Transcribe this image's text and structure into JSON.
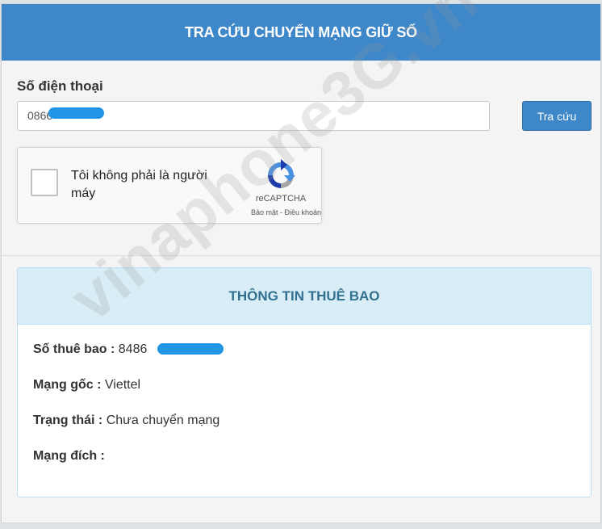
{
  "header": {
    "title": "TRA CỨU CHUYỂN MẠNG GIỮ SỐ"
  },
  "form": {
    "phone_label": "Số điện thoại",
    "phone_value": "0866",
    "search_label": "Tra cứu"
  },
  "captcha": {
    "label": "Tôi không phải là người máy",
    "brand": "reCAPTCHA",
    "links": "Bảo mật - Điều khoản"
  },
  "info": {
    "title": "THÔNG TIN THUÊ BAO",
    "subscriber_label": "Số thuê bao :",
    "subscriber_value": "8486",
    "origin_label": "Mạng gốc :",
    "origin_value": "Viettel",
    "status_label": "Trạng thái :",
    "status_value": "Chưa chuyển mạng",
    "dest_label": "Mạng đích :",
    "dest_value": ""
  },
  "watermark": "vinaphone3G.vn",
  "colors": {
    "header": "#3e87c9",
    "info_header": "#d9edf7",
    "info_title": "#31708f",
    "redaction": "#2196e6"
  },
  "icons": [
    "recaptcha-logo-icon",
    "checkbox-icon"
  ]
}
